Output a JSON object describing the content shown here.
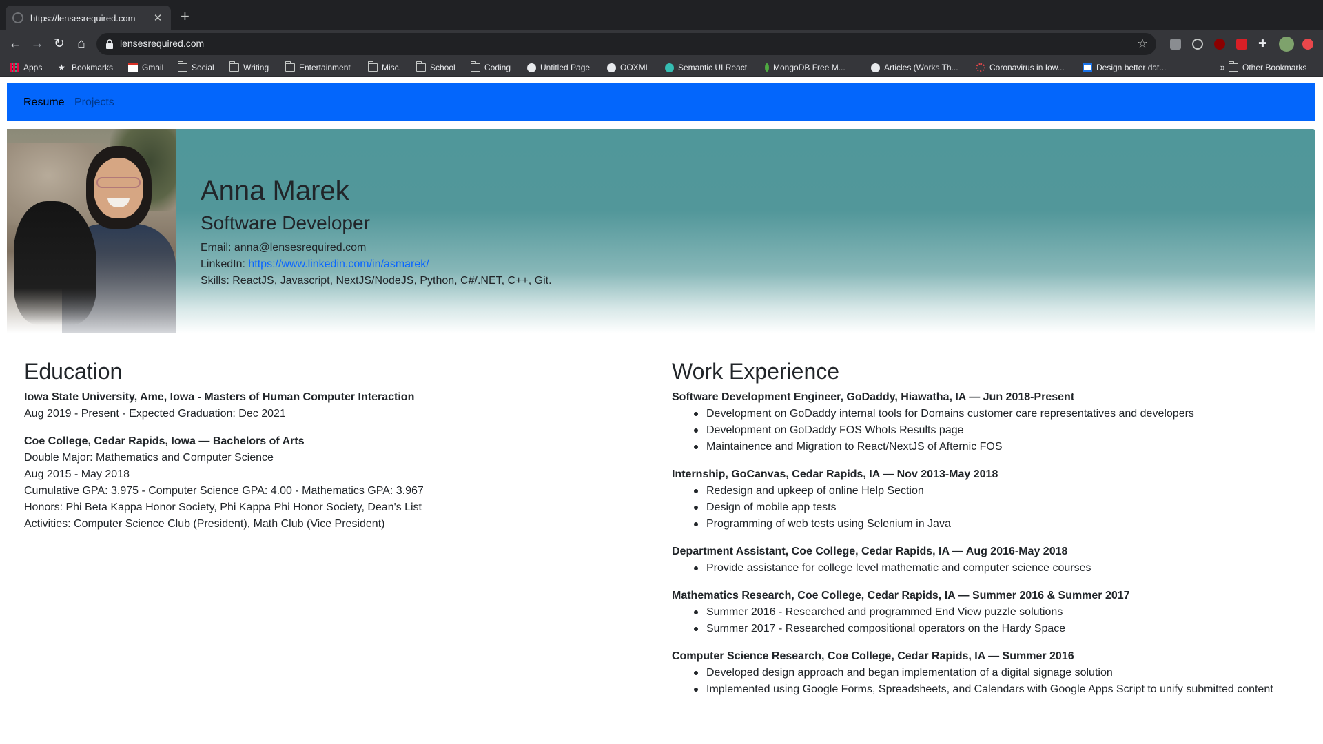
{
  "browser": {
    "tab_title": "https://lensesrequired.com",
    "new_tab": "+",
    "url": "lensesrequired.com",
    "bookmarks": [
      "Apps",
      "Bookmarks",
      "Gmail",
      "Social",
      "Writing",
      "Entertainment",
      "Misc.",
      "School",
      "Coding",
      "Untitled Page",
      "OOXML",
      "Semantic UI React",
      "MongoDB Free M...",
      "Articles (Works Th...",
      "Coronavirus in Iow...",
      "Design better dat..."
    ],
    "more_bookmarks": "»",
    "other_bookmarks": "Other Bookmarks"
  },
  "nav": {
    "resume": "Resume",
    "projects": "Projects"
  },
  "profile": {
    "name": "Anna Marek",
    "title": "Software Developer",
    "email_label": "Email: ",
    "email": "anna@lensesrequired.com",
    "linkedin_label": "LinkedIn: ",
    "linkedin": "https://www.linkedin.com/in/asmarek/",
    "skills_label": "Skills: ",
    "skills": "ReactJS, Javascript, NextJS/NodeJS, Python, C#/.NET, C++, Git."
  },
  "education": {
    "heading": "Education",
    "entries": [
      {
        "title": "Iowa State University, Ame, Iowa - Masters of Human Computer Interaction",
        "lines": [
          "Aug 2019 - Present - Expected Graduation: Dec 2021"
        ]
      },
      {
        "title": "Coe College, Cedar Rapids, Iowa — Bachelors of Arts",
        "lines": [
          "Double Major: Mathematics and Computer Science",
          "Aug 2015 - May 2018",
          "Cumulative GPA: 3.975 - Computer Science GPA: 4.00 - Mathematics GPA: 3.967",
          "Honors: Phi Beta Kappa Honor Society, Phi Kappa Phi Honor Society, Dean's List",
          "Activities: Computer Science Club (President), Math Club (Vice President)"
        ]
      }
    ]
  },
  "work": {
    "heading": "Work Experience",
    "entries": [
      {
        "title": "Software Development Engineer, GoDaddy, Hiawatha, IA — Jun 2018-Present",
        "bullets": [
          "Development on GoDaddy internal tools for Domains customer care representatives and developers",
          "Development on GoDaddy FOS WhoIs Results page",
          "Maintainence and Migration to React/NextJS of Afternic FOS"
        ]
      },
      {
        "title": "Internship, GoCanvas, Cedar Rapids, IA — Nov 2013-May 2018",
        "bullets": [
          "Redesign and upkeep of online Help Section",
          "Design of mobile app tests",
          "Programming of web tests using Selenium in Java"
        ]
      },
      {
        "title": "Department Assistant, Coe College, Cedar Rapids, IA — Aug 2016-May 2018",
        "bullets": [
          "Provide assistance for college level mathematic and computer science courses"
        ]
      },
      {
        "title": "Mathematics Research, Coe College, Cedar Rapids, IA — Summer 2016 & Summer 2017",
        "bullets": [
          "Summer 2016 - Researched and programmed End View puzzle solutions",
          "Summer 2017 - Researched compositional operators on the Hardy Space"
        ]
      },
      {
        "title": "Computer Science Research, Coe College, Cedar Rapids, IA — Summer 2016",
        "bullets": [
          "Developed design approach and began implementation of a digital signage solution",
          "Implemented using Google Forms, Spreadsheets, and Calendars with Google Apps Script to unify submitted content"
        ]
      }
    ]
  }
}
